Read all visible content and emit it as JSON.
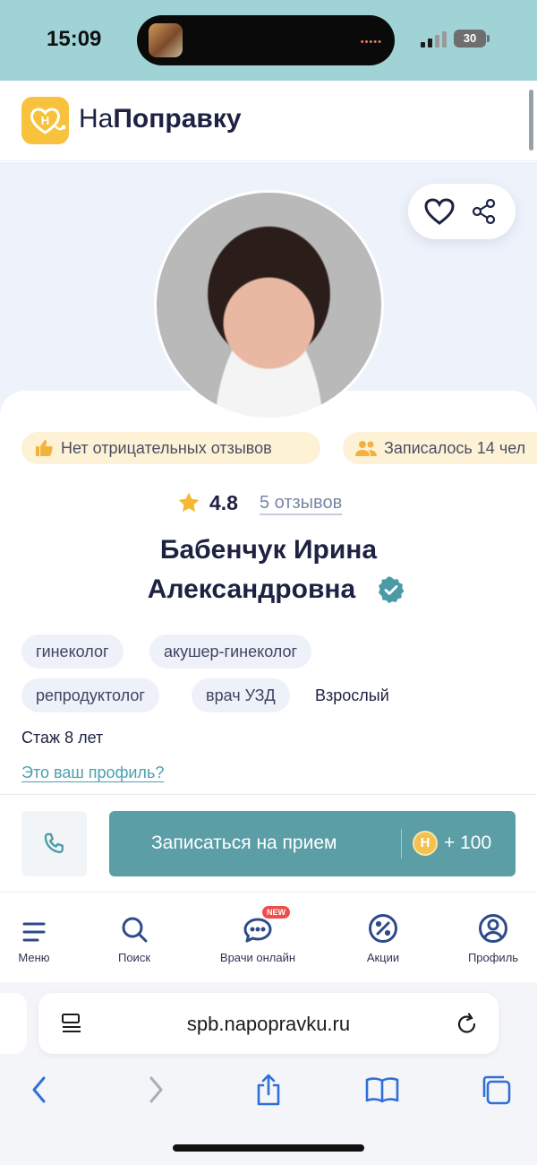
{
  "status_bar": {
    "time": "15:09",
    "battery": "30"
  },
  "header": {
    "logo_prefix": "На",
    "logo_bold": "Поправку",
    "logo_icon": "heart-stethoscope-logo"
  },
  "profile_actions": {
    "favorite_icon": "heart-icon",
    "share_icon": "share-icon"
  },
  "badges": [
    {
      "icon": "thumbs-up-icon",
      "text": "Нет отрицательных отзывов"
    },
    {
      "icon": "users-icon",
      "text": "Записалось 14 чел"
    }
  ],
  "rating": {
    "value": "4.8",
    "reviews": "5 отзывов"
  },
  "doctor": {
    "name_line1": "Бабенчук Ирина",
    "name_line2": "Александровна",
    "verified_icon": "verified-check-icon"
  },
  "specialties": [
    "гинеколог",
    "акушер-гинеколог",
    "репродуктолог",
    "врач УЗД"
  ],
  "age_group": "Взрослый",
  "experience": "Стаж 8 лет",
  "profile_claim_link": "Это ваш профиль?",
  "booking": {
    "call_icon": "phone-icon",
    "book_label": "Записаться на прием",
    "coin_letter": "Н",
    "bonus": "+ 100"
  },
  "bottom_nav": {
    "new_badge": "NEW",
    "items": [
      {
        "icon": "menu-icon",
        "label": "Меню"
      },
      {
        "icon": "search-icon",
        "label": "Поиск"
      },
      {
        "icon": "chat-icon",
        "label": "Врачи онлайн"
      },
      {
        "icon": "discount-icon",
        "label": "Акции"
      },
      {
        "icon": "user-icon",
        "label": "Профиль"
      }
    ]
  },
  "browser": {
    "url": "spb.napopravku.ru"
  },
  "colors": {
    "accent": "#5b9ea6",
    "badge_bg": "#fdf2d6",
    "logo": "#f9c23c",
    "status_bar": "#9fd3d6",
    "link": "#4aa0b0"
  }
}
